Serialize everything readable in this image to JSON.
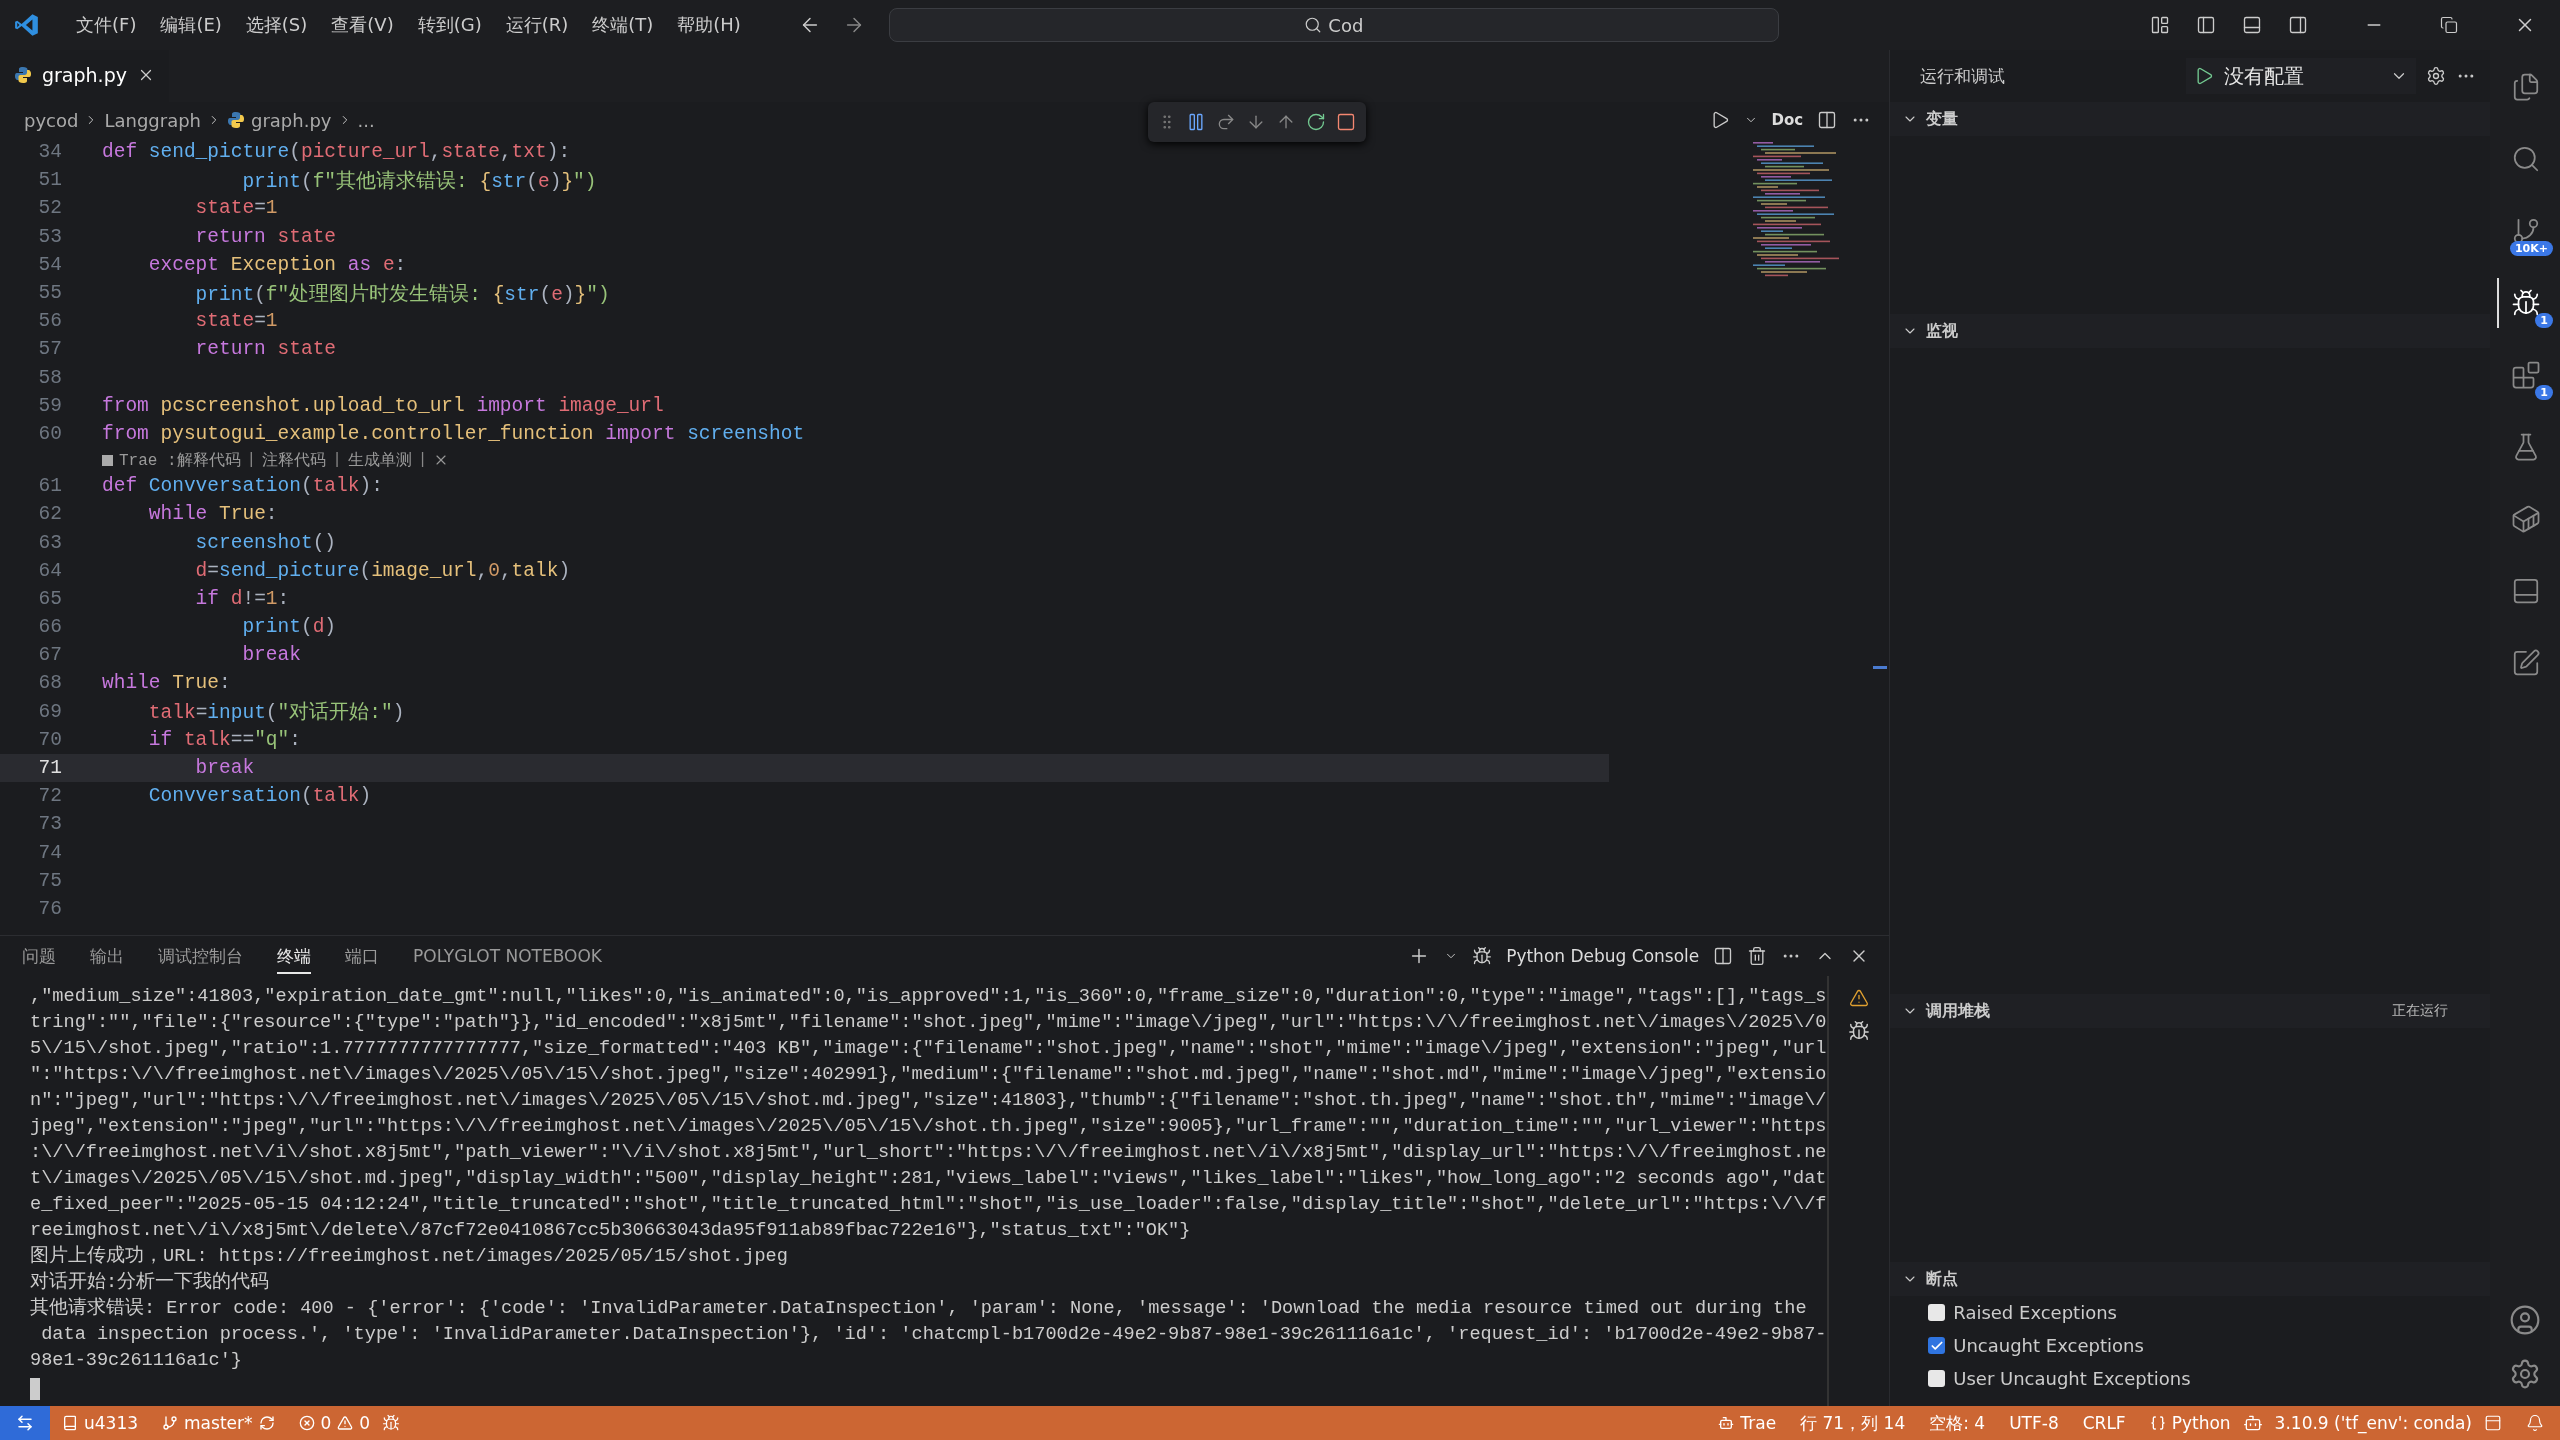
{
  "menu": [
    "文件(F)",
    "编辑(E)",
    "选择(S)",
    "查看(V)",
    "转到(G)",
    "运行(R)",
    "终端(T)",
    "帮助(H)"
  ],
  "search": {
    "value": "Cod"
  },
  "editor_tabs": [
    {
      "label": "graph.py",
      "selected": true
    }
  ],
  "editor_actions": {
    "doc": "Doc"
  },
  "breadcrumb": [
    "pycod",
    "Langgraph",
    "graph.py",
    "..."
  ],
  "code_lines": [
    {
      "kind": "code",
      "number": "34",
      "selected": false,
      "tokens": [
        {
          "text": "def ",
          "kind": "kw"
        },
        {
          "text": "send_picture",
          "kind": "fn"
        },
        {
          "text": "(",
          "kind": "p"
        },
        {
          "text": "picture_url",
          "kind": "var"
        },
        {
          "text": ",",
          "kind": "p"
        },
        {
          "text": "state",
          "kind": "var"
        },
        {
          "text": ",",
          "kind": "p"
        },
        {
          "text": "txt",
          "kind": "var"
        },
        {
          "text": "):",
          "kind": "p"
        }
      ]
    },
    {
      "kind": "code",
      "number": "51",
      "selected": false,
      "tokens": [
        {
          "text": "            print",
          "kind": "fn"
        },
        {
          "text": "(",
          "kind": "p"
        },
        {
          "text": "f\"其他请求错误: ",
          "kind": "str"
        },
        {
          "text": "{",
          "kind": "cls"
        },
        {
          "text": "str",
          "kind": "fn"
        },
        {
          "text": "(",
          "kind": "p"
        },
        {
          "text": "e",
          "kind": "var"
        },
        {
          "text": ")",
          "kind": "p"
        },
        {
          "text": "}",
          "kind": "cls"
        },
        {
          "text": "\")",
          "kind": "str"
        }
      ]
    },
    {
      "kind": "code",
      "number": "52",
      "selected": false,
      "tokens": [
        {
          "text": "        state",
          "kind": "var"
        },
        {
          "text": "=",
          "kind": "p"
        },
        {
          "text": "1",
          "kind": "num"
        }
      ]
    },
    {
      "kind": "code",
      "number": "53",
      "selected": false,
      "tokens": [
        {
          "text": "        return ",
          "kind": "kw"
        },
        {
          "text": "state",
          "kind": "var"
        }
      ]
    },
    {
      "kind": "code",
      "number": "54",
      "selected": false,
      "tokens": [
        {
          "text": "    except ",
          "kind": "kw"
        },
        {
          "text": "Exception ",
          "kind": "cls"
        },
        {
          "text": "as ",
          "kind": "kw"
        },
        {
          "text": "e",
          "kind": "var"
        },
        {
          "text": ":",
          "kind": "p"
        }
      ]
    },
    {
      "kind": "code",
      "number": "55",
      "selected": false,
      "tokens": [
        {
          "text": "        print",
          "kind": "fn"
        },
        {
          "text": "(",
          "kind": "p"
        },
        {
          "text": "f\"处理图片时发生错误: ",
          "kind": "str"
        },
        {
          "text": "{",
          "kind": "cls"
        },
        {
          "text": "str",
          "kind": "fn"
        },
        {
          "text": "(",
          "kind": "p"
        },
        {
          "text": "e",
          "kind": "var"
        },
        {
          "text": ")",
          "kind": "p"
        },
        {
          "text": "}",
          "kind": "cls"
        },
        {
          "text": "\")",
          "kind": "str"
        }
      ]
    },
    {
      "kind": "code",
      "number": "56",
      "selected": false,
      "tokens": [
        {
          "text": "        state",
          "kind": "var"
        },
        {
          "text": "=",
          "kind": "p"
        },
        {
          "text": "1",
          "kind": "num"
        }
      ]
    },
    {
      "kind": "code",
      "number": "57",
      "selected": false,
      "tokens": [
        {
          "text": "        return ",
          "kind": "kw"
        },
        {
          "text": "state",
          "kind": "var"
        }
      ]
    },
    {
      "kind": "code",
      "number": "58",
      "selected": false
    },
    {
      "kind": "code",
      "number": "59",
      "selected": false,
      "tokens": [
        {
          "text": "from ",
          "kind": "kw"
        },
        {
          "text": "pcscreenshot.upload_to_url ",
          "kind": "cls"
        },
        {
          "text": "import ",
          "kind": "kw"
        },
        {
          "text": "image_url",
          "kind": "var"
        }
      ]
    },
    {
      "kind": "code",
      "number": "60",
      "selected": false,
      "tokens": [
        {
          "text": "from ",
          "kind": "kw"
        },
        {
          "text": "pysutogui_example.controller_function ",
          "kind": "cls"
        },
        {
          "text": "import ",
          "kind": "kw"
        },
        {
          "text": "screenshot",
          "kind": "fn"
        }
      ]
    },
    {
      "kind": "codelens",
      "label": "Trae :解释代码",
      "actions": [
        "注释代码",
        "生成单测"
      ],
      "separator": "|"
    },
    {
      "kind": "code",
      "number": "61",
      "selected": false,
      "tokens": [
        {
          "text": "def ",
          "kind": "kw"
        },
        {
          "text": "Convversation",
          "kind": "fn"
        },
        {
          "text": "(",
          "kind": "p"
        },
        {
          "text": "talk",
          "kind": "var"
        },
        {
          "text": "):",
          "kind": "p"
        }
      ]
    },
    {
      "kind": "code",
      "number": "62",
      "selected": false,
      "tokens": [
        {
          "text": "    while ",
          "kind": "kw"
        },
        {
          "text": "True",
          "kind": "cls"
        },
        {
          "text": ":",
          "kind": "p"
        }
      ]
    },
    {
      "kind": "code",
      "number": "63",
      "selected": false,
      "tokens": [
        {
          "text": "        screenshot",
          "kind": "fn"
        },
        {
          "text": "()",
          "kind": "p"
        }
      ]
    },
    {
      "kind": "code",
      "number": "64",
      "selected": false,
      "tokens": [
        {
          "text": "        d",
          "kind": "var"
        },
        {
          "text": "=",
          "kind": "p"
        },
        {
          "text": "send_picture",
          "kind": "fn"
        },
        {
          "text": "(",
          "kind": "p"
        },
        {
          "text": "image_url",
          "kind": "cls"
        },
        {
          "text": ",",
          "kind": "p"
        },
        {
          "text": "0",
          "kind": "num"
        },
        {
          "text": ",",
          "kind": "p"
        },
        {
          "text": "talk",
          "kind": "cls"
        },
        {
          "text": ")",
          "kind": "p"
        }
      ]
    },
    {
      "kind": "code",
      "number": "65",
      "selected": false,
      "tokens": [
        {
          "text": "        if ",
          "kind": "kw"
        },
        {
          "text": "d",
          "kind": "var"
        },
        {
          "text": "!=",
          "kind": "p"
        },
        {
          "text": "1",
          "kind": "num"
        },
        {
          "text": ":",
          "kind": "p"
        }
      ]
    },
    {
      "kind": "code",
      "number": "66",
      "selected": false,
      "tokens": [
        {
          "text": "            print",
          "kind": "fn"
        },
        {
          "text": "(",
          "kind": "p"
        },
        {
          "text": "d",
          "kind": "var"
        },
        {
          "text": ")",
          "kind": "p"
        }
      ]
    },
    {
      "kind": "code",
      "number": "67",
      "selected": false,
      "tokens": [
        {
          "text": "            break",
          "kind": "kw"
        }
      ]
    },
    {
      "kind": "code",
      "number": "68",
      "selected": false,
      "tokens": [
        {
          "text": "while ",
          "kind": "kw"
        },
        {
          "text": "True",
          "kind": "cls"
        },
        {
          "text": ":",
          "kind": "p"
        }
      ]
    },
    {
      "kind": "code",
      "number": "69",
      "selected": false,
      "tokens": [
        {
          "text": "    talk",
          "kind": "var"
        },
        {
          "text": "=",
          "kind": "p"
        },
        {
          "text": "input",
          "kind": "fn"
        },
        {
          "text": "(",
          "kind": "p"
        },
        {
          "text": "\"对话开始:\"",
          "kind": "str"
        },
        {
          "text": ")",
          "kind": "p"
        }
      ]
    },
    {
      "kind": "code",
      "number": "70",
      "selected": false,
      "tokens": [
        {
          "text": "    if ",
          "kind": "kw"
        },
        {
          "text": "talk",
          "kind": "var"
        },
        {
          "text": "==",
          "kind": "p"
        },
        {
          "text": "\"q\"",
          "kind": "str"
        },
        {
          "text": ":",
          "kind": "p"
        }
      ]
    },
    {
      "kind": "code",
      "number": "71",
      "selected": true,
      "tokens": [
        {
          "text": "        break",
          "kind": "kw"
        }
      ]
    },
    {
      "kind": "code",
      "number": "72",
      "selected": false,
      "tokens": [
        {
          "text": "    Convversation",
          "kind": "fn"
        },
        {
          "text": "(",
          "kind": "p"
        },
        {
          "text": "talk",
          "kind": "var"
        },
        {
          "text": ")",
          "kind": "p"
        }
      ]
    },
    {
      "kind": "code",
      "number": "73",
      "selected": false
    },
    {
      "kind": "code",
      "number": "74",
      "selected": false
    },
    {
      "kind": "code",
      "number": "75",
      "selected": false
    },
    {
      "kind": "code",
      "number": "76",
      "selected": false
    }
  ],
  "panel": {
    "tabs": [
      {
        "label": "问题",
        "selected": false
      },
      {
        "label": "输出",
        "selected": false
      },
      {
        "label": "调试控制台",
        "selected": false
      },
      {
        "label": "终端",
        "selected": true
      },
      {
        "label": "端口",
        "selected": false
      },
      {
        "label": "POLYGLOT NOTEBOOK",
        "selected": false
      }
    ],
    "terminal_name": "Python Debug Console",
    "lines": [
      ",\"medium_size\":41803,\"expiration_date_gmt\":null,\"likes\":0,\"is_animated\":0,\"is_approved\":1,\"is_360\":0,\"frame_size\":0,\"duration\":0,\"type\":\"image\",\"tags\":[],\"tags_s",
      "tring\":\"\",\"file\":{\"resource\":{\"type\":\"path\"}},\"id_encoded\":\"x8j5mt\",\"filename\":\"shot.jpeg\",\"mime\":\"image\\/jpeg\",\"url\":\"https:\\/\\/freeimghost.net\\/images\\/2025\\/0",
      "5\\/15\\/shot.jpeg\",\"ratio\":1.7777777777777777,\"size_formatted\":\"403 KB\",\"image\":{\"filename\":\"shot.jpeg\",\"name\":\"shot\",\"mime\":\"image\\/jpeg\",\"extension\":\"jpeg\",\"url",
      "\":\"https:\\/\\/freeimghost.net\\/images\\/2025\\/05\\/15\\/shot.jpeg\",\"size\":402991},\"medium\":{\"filename\":\"shot.md.jpeg\",\"name\":\"shot.md\",\"mime\":\"image\\/jpeg\",\"extensio",
      "n\":\"jpeg\",\"url\":\"https:\\/\\/freeimghost.net\\/images\\/2025\\/05\\/15\\/shot.md.jpeg\",\"size\":41803},\"thumb\":{\"filename\":\"shot.th.jpeg\",\"name\":\"shot.th\",\"mime\":\"image\\/",
      "jpeg\",\"extension\":\"jpeg\",\"url\":\"https:\\/\\/freeimghost.net\\/images\\/2025\\/05\\/15\\/shot.th.jpeg\",\"size\":9005},\"url_frame\":\"\",\"duration_time\":\"\",\"url_viewer\":\"https",
      ":\\/\\/freeimghost.net\\/i\\/shot.x8j5mt\",\"path_viewer\":\"\\/i\\/shot.x8j5mt\",\"url_short\":\"https:\\/\\/freeimghost.net\\/i\\/x8j5mt\",\"display_url\":\"https:\\/\\/freeimghost.ne",
      "t\\/images\\/2025\\/05\\/15\\/shot.md.jpeg\",\"display_width\":\"500\",\"display_height\":281,\"views_label\":\"views\",\"likes_label\":\"likes\",\"how_long_ago\":\"2 seconds ago\",\"dat",
      "e_fixed_peer\":\"2025-05-15 04:12:24\",\"title_truncated\":\"shot\",\"title_truncated_html\":\"shot\",\"is_use_loader\":false,\"display_title\":\"shot\",\"delete_url\":\"https:\\/\\/f",
      "reeimghost.net\\/i\\/x8j5mt\\/delete\\/87cf72e0410867cc5b30663043da95f911ab89fbac722e16\"},\"status_txt\":\"OK\"}",
      "图片上传成功，URL: https://freeimghost.net/images/2025/05/15/shot.jpeg",
      "对话开始:分析一下我的代码",
      "其他请求错误: Error code: 400 - {'error': {'code': 'InvalidParameter.DataInspection', 'param': None, 'message': 'Download the media resource timed out during the",
      " data inspection process.', 'type': 'InvalidParameter.DataInspection'}, 'id': 'chatcmpl-b1700d2e-49e2-9b87-98e1-39c261116a1c', 'request_id': 'b1700d2e-49e2-9b87-",
      "98e1-39c261116a1c'}"
    ]
  },
  "sidebar": {
    "title": "运行和调试",
    "config": "没有配置",
    "sections": [
      {
        "kind": "variables",
        "title": "变量",
        "expanded": true
      },
      {
        "kind": "watch",
        "title": "监视",
        "expanded": true
      },
      {
        "kind": "callstack",
        "title": "调用堆栈",
        "expanded": true,
        "status": "正在运行"
      },
      {
        "kind": "breakpoints",
        "title": "断点",
        "expanded": true,
        "items": [
          {
            "label": "Raised Exceptions",
            "checked": false
          },
          {
            "label": "Uncaught Exceptions",
            "checked": true
          },
          {
            "label": "User Uncaught Exceptions",
            "checked": false
          }
        ]
      }
    ]
  },
  "activity_bar": [
    {
      "selected": false
    },
    {
      "selected": false
    },
    {
      "selected": false,
      "badge": "10K+"
    },
    {
      "selected": true,
      "badge": "1"
    },
    {
      "selected": false,
      "badge": "1"
    },
    {
      "selected": false
    },
    {
      "selected": false
    },
    {
      "selected": false
    },
    {
      "selected": false
    }
  ],
  "status_bar": {
    "repo": "u4313",
    "branch": "master*",
    "errors": "0",
    "warnings": "0",
    "trae": "Trae",
    "position": "行 71，列 14",
    "spaces": "空格: 4",
    "encoding": "UTF-8",
    "eol": "CRLF",
    "language": "Python",
    "interpreter": "3.10.9 ('tf_env': conda)"
  }
}
